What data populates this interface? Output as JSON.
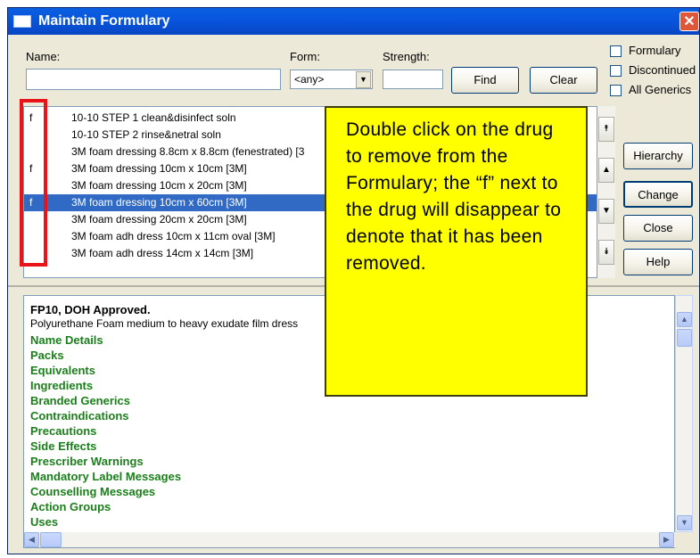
{
  "window": {
    "title": "Maintain Formulary"
  },
  "search": {
    "name_label": "Name:",
    "name_value": "",
    "form_label": "Form:",
    "form_value": "<any>",
    "strength_label": "Strength:",
    "strength_value": "",
    "find_label": "Find",
    "clear_label": "Clear"
  },
  "filters": [
    {
      "label": "Formulary",
      "checked": false
    },
    {
      "label": "Discontinued",
      "checked": false
    },
    {
      "label": "All Generics",
      "checked": false
    }
  ],
  "drug_list": [
    {
      "flag": "f",
      "name": "10-10 STEP 1 clean&disinfect soln"
    },
    {
      "flag": "",
      "name": "10-10 STEP 2 rinse&netral soln"
    },
    {
      "flag": "",
      "name": "3M foam dressing 8.8cm x 8.8cm (fenestrated) [3"
    },
    {
      "flag": "f",
      "name": "3M foam dressing 10cm x 10cm [3M]"
    },
    {
      "flag": "",
      "name": "3M foam dressing 10cm x 20cm [3M]"
    },
    {
      "flag": "f",
      "name": "3M foam dressing 10cm x 60cm [3M]",
      "selected": true
    },
    {
      "flag": "",
      "name": "3M foam dressing 20cm x 20cm [3M]"
    },
    {
      "flag": "",
      "name": "3M foam adh dress 10cm x 11cm oval [3M]"
    },
    {
      "flag": "",
      "name": "3M foam adh dress 14cm x 14cm [3M]"
    }
  ],
  "actions": {
    "hierarchy": "Hierarchy",
    "change": "Change",
    "close": "Close",
    "help": "Help"
  },
  "details": {
    "title": "FP10, DOH Approved.",
    "description": "Polyurethane Foam medium to heavy exudate film dress",
    "links": [
      "Name Details",
      "Packs",
      "Equivalents",
      "Ingredients",
      "Branded Generics",
      "Contraindications",
      "Precautions",
      "Side Effects",
      "Prescriber Warnings",
      "Mandatory Label Messages",
      "Counselling Messages",
      "Action Groups",
      "Uses"
    ]
  },
  "annotation": {
    "text": "Double click on the drug to remove from the Formulary; the “f” next to the drug will disappear to denote that it has been removed.",
    "box_color": "#ffff00",
    "highlight_color": "#e8141a"
  },
  "colors": {
    "titlebar": "#0855dd",
    "selection": "#316ac5",
    "link": "#1a7f1a"
  }
}
